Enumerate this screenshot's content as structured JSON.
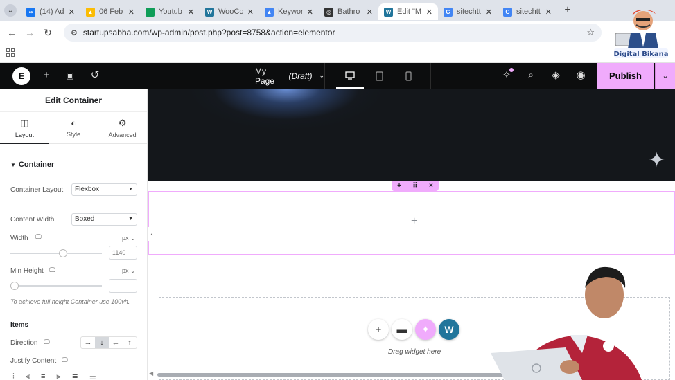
{
  "browser": {
    "tabs": [
      {
        "title": "(14) Ad",
        "color": "#1877f2",
        "glyph": "∞"
      },
      {
        "title": "06 Feb",
        "color": "#fbbc04",
        "glyph": "▲"
      },
      {
        "title": "Youtub",
        "color": "#0f9d58",
        "glyph": "+"
      },
      {
        "title": "WooCo",
        "color": "#21759b",
        "glyph": "W"
      },
      {
        "title": "Keywor",
        "color": "#4285f4",
        "glyph": "▲"
      },
      {
        "title": "Bathro",
        "color": "#333333",
        "glyph": "◎"
      },
      {
        "title": "Edit \"M",
        "color": "#21759b",
        "glyph": "W"
      },
      {
        "title": "sitechtt",
        "color": "#4285f4",
        "glyph": "G"
      },
      {
        "title": "sitechtt",
        "color": "#4285f4",
        "glyph": "G"
      }
    ],
    "active_tab_index": 6,
    "url": "startupsabha.com/wp-admin/post.php?post=8758&action=elementor"
  },
  "mascot": {
    "text": "Digital Bikana"
  },
  "editor_bar": {
    "logo": "E",
    "page_title": "My Page",
    "page_status": "(Draft)",
    "publish_label": "Publish"
  },
  "panel": {
    "title": "Edit Container",
    "tabs": [
      {
        "label": "Layout",
        "icon": "◫"
      },
      {
        "label": "Style",
        "icon": "◐"
      },
      {
        "label": "Advanced",
        "icon": "⚙"
      }
    ],
    "section": "Container",
    "container_layout": {
      "label": "Container Layout",
      "value": "Flexbox"
    },
    "content_width": {
      "label": "Content Width",
      "value": "Boxed"
    },
    "width": {
      "label": "Width",
      "unit": "px",
      "value": "1140",
      "fraction": 0.58
    },
    "min_height": {
      "label": "Min Height",
      "unit": "px",
      "value": "",
      "fraction": 0.0
    },
    "hint": "To achieve full height Container use 100vh.",
    "items_section": "Items",
    "direction": {
      "label": "Direction",
      "options": [
        "→",
        "↓",
        "←",
        "↑"
      ],
      "selected": 1
    },
    "justify": {
      "label": "Justify Content",
      "options": [
        "⫶",
        "⫷",
        "≡",
        "⫸",
        "≣",
        "☰"
      ]
    }
  },
  "canvas": {
    "container_toolbar": [
      "+",
      "⠿",
      "×"
    ],
    "add_plus": "+",
    "drop_text": "Drag widget here",
    "drop_buttons": [
      {
        "glyph": "+",
        "bg": "#ffffff",
        "fg": "#333333"
      },
      {
        "glyph": "▬",
        "bg": "#ffffff",
        "fg": "#333333"
      },
      {
        "glyph": "✦",
        "bg": "#f0abfc",
        "fg": "#ffffff"
      },
      {
        "glyph": "W",
        "bg": "#21759b",
        "fg": "#ffffff"
      }
    ]
  },
  "colors": {
    "accent": "#f0abfc",
    "dark": "#0c0d0e"
  }
}
